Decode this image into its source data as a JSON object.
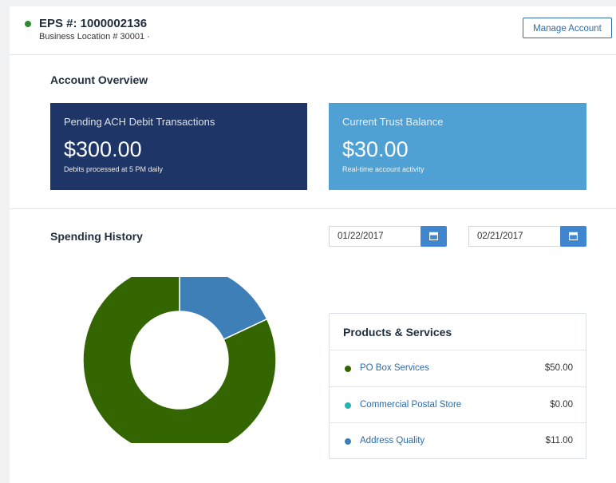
{
  "header": {
    "eps_label": "EPS #: 1000002136",
    "business_location": "Business Location # 30001 ·",
    "manage_account_label": "Manage Account",
    "status_color": "#2e8b2e"
  },
  "overview": {
    "title": "Account Overview",
    "tiles": [
      {
        "label": "Pending ACH Debit Transactions",
        "value": "$300.00",
        "sub": "Debits processed at 5 PM daily",
        "color": "#1e3567"
      },
      {
        "label": "Current Trust Balance",
        "value": "$30.00",
        "sub": "Real-time account activity",
        "color": "#4fa1d3"
      }
    ]
  },
  "spending": {
    "title": "Spending History",
    "start_date": "01/22/2017",
    "end_date": "02/21/2017",
    "calendar_icon": "calendar-icon"
  },
  "products": {
    "title": "Products & Services",
    "items": [
      {
        "name": "PO Box Services",
        "amount": "$50.00",
        "color": "#336600"
      },
      {
        "name": "Commercial Postal Store",
        "amount": "$0.00",
        "color": "#29b3b0"
      },
      {
        "name": "Address Quality",
        "amount": "$11.00",
        "color": "#3f7fb8"
      }
    ]
  },
  "chart_data": {
    "type": "pie",
    "variant": "donut",
    "categories": [
      "PO Box Services",
      "Commercial Postal Store",
      "Address Quality"
    ],
    "values": [
      50.0,
      0.0,
      11.0
    ],
    "colors": [
      "#336600",
      "#29b3b0",
      "#3f7fb8"
    ]
  }
}
